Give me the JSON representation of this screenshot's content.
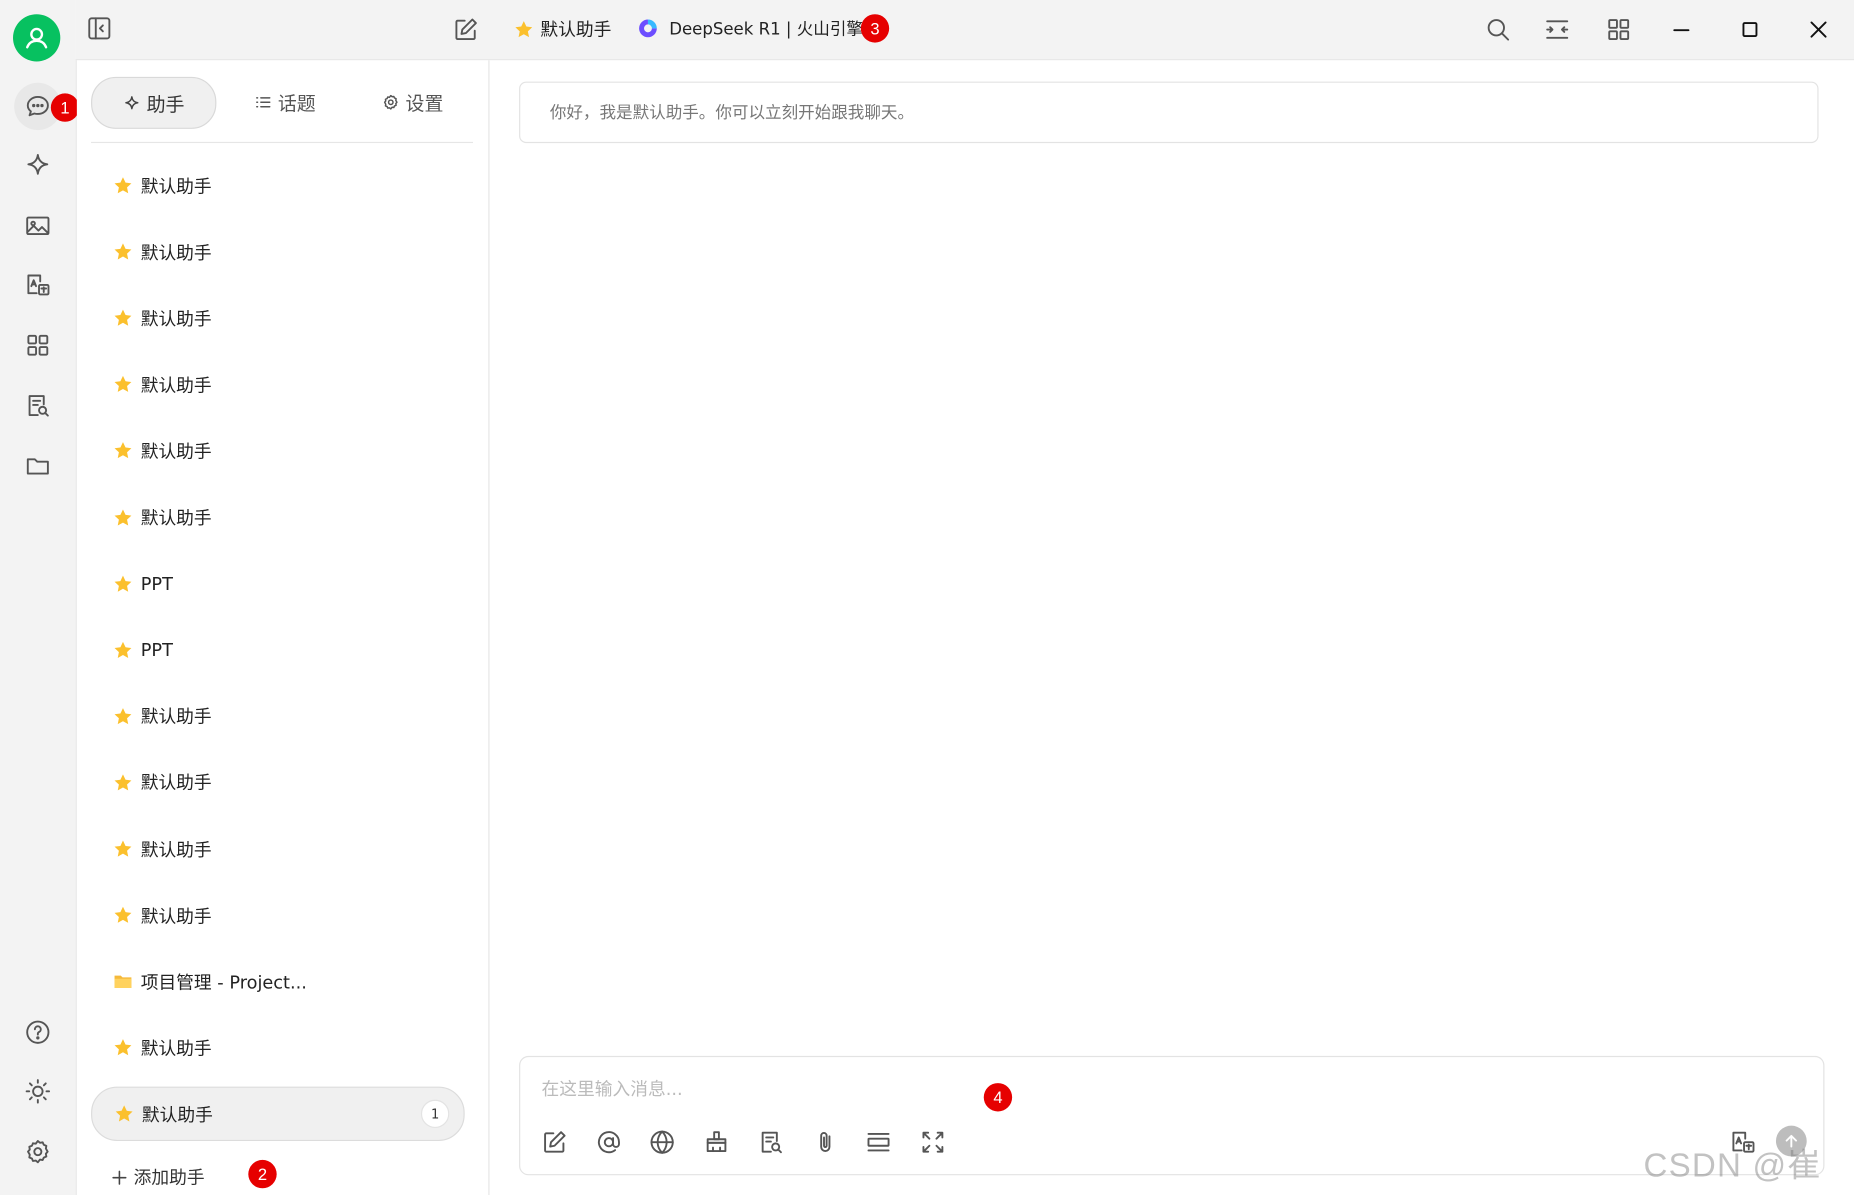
{
  "topbar": {
    "assistant_name": "默认助手",
    "model_name": "DeepSeek R1 | 火山引擎"
  },
  "side_tabs": [
    {
      "label": "助手"
    },
    {
      "label": "话题"
    },
    {
      "label": "设置"
    }
  ],
  "assistants": [
    {
      "label": "默认助手",
      "icon": "star-emoji"
    },
    {
      "label": "默认助手",
      "icon": "star-emoji"
    },
    {
      "label": "默认助手",
      "icon": "star-emoji"
    },
    {
      "label": "默认助手",
      "icon": "star-emoji"
    },
    {
      "label": "默认助手",
      "icon": "star-emoji"
    },
    {
      "label": "默认助手",
      "icon": "star-emoji"
    },
    {
      "label": "PPT",
      "icon": "star-emoji"
    },
    {
      "label": "PPT",
      "icon": "star-emoji"
    },
    {
      "label": "默认助手",
      "icon": "star-emoji"
    },
    {
      "label": "默认助手",
      "icon": "star-emoji"
    },
    {
      "label": "默认助手",
      "icon": "star-emoji"
    },
    {
      "label": "默认助手",
      "icon": "star-emoji"
    },
    {
      "label": "项目管理 - Project...",
      "icon": "folder-emoji"
    },
    {
      "label": "默认助手",
      "icon": "star-emoji"
    },
    {
      "label": "默认助手",
      "icon": "star-emoji",
      "active": true,
      "count": "1"
    }
  ],
  "add_assistant_label": "添加助手",
  "chat": {
    "greeting": "你好，我是默认助手。你可以立刻开始跟我聊天。",
    "input_placeholder": "在这里输入消息..."
  },
  "annotations": [
    "1",
    "2",
    "3",
    "4"
  ],
  "watermark": "CSDN @崔澈",
  "colors": {
    "accent": "#07c160",
    "badge": "#e60000",
    "star": "#fbc02d"
  }
}
